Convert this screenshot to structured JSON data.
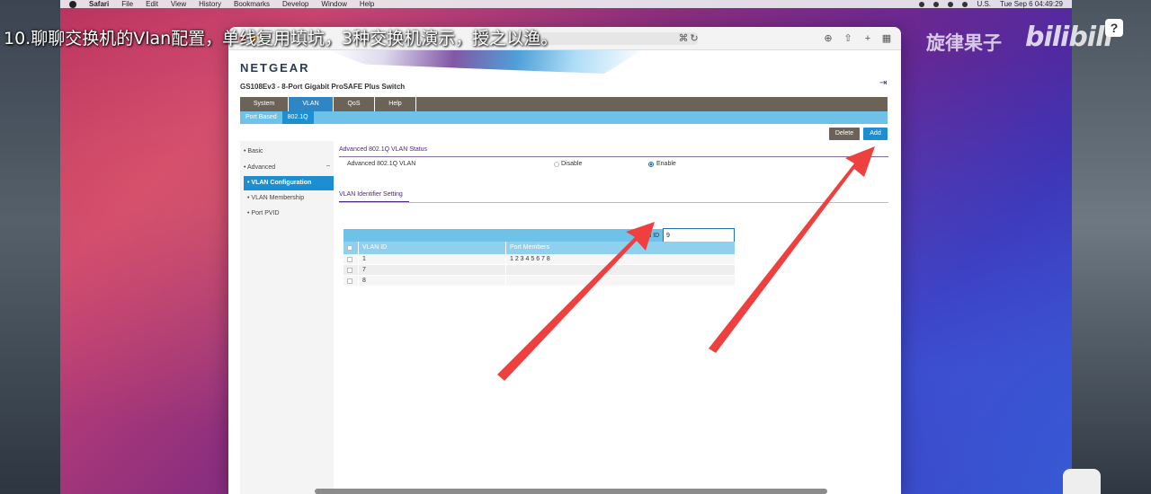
{
  "menubar": {
    "app": "Safari",
    "items": [
      "File",
      "Edit",
      "View",
      "History",
      "Bookmarks",
      "Develop",
      "Window",
      "Help"
    ],
    "input_source": "U.S.",
    "clock": "Tue Sep 6 04:49:29"
  },
  "caption": "10.聊聊交换机的Vlan配置，单线复用填坑，3种交换机演示，授之以渔。",
  "watermark": "旋律果子",
  "platform_logo": "bilibili",
  "help_button": "?",
  "window": {
    "brand": "NETGEAR",
    "product": "GS108Ev3 - 8-Port Gigabit ProSAFE Plus Switch",
    "nav_tabs": [
      "System",
      "VLAN",
      "QoS",
      "Help"
    ],
    "active_tab": "VLAN",
    "sub_tabs": [
      "Port Based",
      "802.1Q"
    ],
    "delete_label": "Delete",
    "add_label": "Add",
    "sidebar": {
      "items": [
        "Basic",
        "Advanced",
        "VLAN Configuration",
        "VLAN Membership",
        "Port PVID"
      ],
      "collapse_symbol": "–"
    },
    "status_section": {
      "title": "Advanced 802.1Q VLAN Status",
      "row_label": "Advanced 802.1Q VLAN",
      "disable_label": "Disable",
      "enable_label": "Enable",
      "selected": "Enable"
    },
    "identifier_section": {
      "title": "VLAN Identifier Setting",
      "vlan_id_label": "VLAN ID",
      "vlan_id_value": "9",
      "columns": [
        "VLAN ID",
        "Port Members"
      ],
      "rows": [
        {
          "id": "1",
          "members": "1 2 3 4 5 6 7 8"
        },
        {
          "id": "7",
          "members": ""
        },
        {
          "id": "8",
          "members": ""
        }
      ]
    }
  },
  "colors": {
    "annotation_arrow": "#ef4040",
    "nav_active": "#2f86c5",
    "subnav": "#6ec2e8",
    "brand": "#2a3a55"
  },
  "icons": [
    "apple-icon",
    "download-icon",
    "share-icon",
    "new-tab-icon",
    "tab-overview-icon",
    "translate-icon",
    "reload-icon",
    "logout-icon"
  ]
}
